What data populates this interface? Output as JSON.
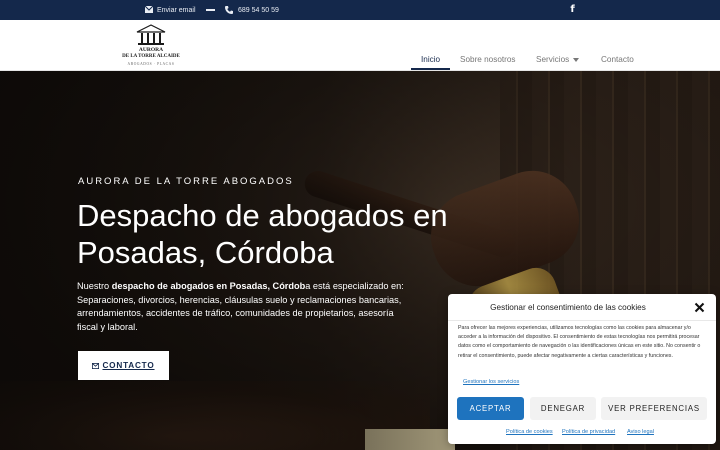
{
  "topbar": {
    "email_icon": "envelope-icon",
    "email_label": "Enviar email",
    "phone_icon": "phone-icon",
    "phone_number": "689 54 50 59",
    "social_icon": "facebook-icon",
    "facebook_glyph": "f"
  },
  "logo": {
    "line1": "AURORA",
    "line2": "DE LA TORRE ALCAIDE",
    "line3": "ABOGADOS · PLACAS"
  },
  "nav": {
    "items": [
      {
        "label": "Inicio",
        "active": true
      },
      {
        "label": "Sobre nosotros"
      },
      {
        "label": "Servicios",
        "has_dropdown": true
      },
      {
        "label": "Contacto"
      }
    ]
  },
  "hero": {
    "eyebrow": "AURORA DE LA TORRE ABOGADOS",
    "headline": "Despacho de abogados en Posadas, Córdoba",
    "intro_prefix": "Nuestro ",
    "intro_bold1": "despacho de abogados en Posadas, Córdob",
    "intro_mid": "a está especializado en: Separaciones,  divorcios, herencias, cláusulas suelo y reclamaciones bancarias, arrendamientos, accidentes de tráfico, comunidades de propietarios, asesoría fiscal y laboral.",
    "cta_label": "CONTACTO",
    "cta_icon": "envelope-icon"
  },
  "cookie_modal": {
    "title": "Gestionar el consentimiento de las cookies",
    "body": "Para ofrecer las mejores experiencias, utilizamos tecnologías como las cookies para almacenar y/o acceder a la información del dispositivo. El consentimiento de estas tecnologías nos permitirá procesar datos como el comportamiento de navegación o las identificaciones únicas en este sitio. No consentir o retirar el consentimiento, puede afectar negativamente a ciertas características y funciones.",
    "manage_link": "Gestionar los servicios",
    "accept": "ACEPTAR",
    "deny": "DENEGAR",
    "preferences": "VER PREFERENCIAS",
    "link_cookies": "Política de cookies",
    "link_privacy": "Política de privacidad",
    "link_legal": "Aviso legal"
  },
  "colors": {
    "topbar_bg": "#14284b",
    "accent_blue": "#1e73be",
    "white": "#ffffff"
  }
}
